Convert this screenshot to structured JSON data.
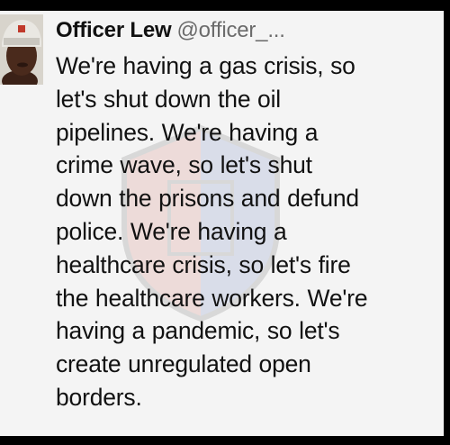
{
  "tweet": {
    "display_name": "Officer Lew",
    "handle": "@officer_...",
    "text_lines": [
      "We're having a gas crisis, so",
      "let's shut down the oil",
      "pipelines. We're having a",
      "crime wave, so let's shut",
      "down the prisons and defund",
      "police. We're having a",
      "healthcare crisis, so let's fire",
      "the healthcare workers. We're",
      "having a pandemic, so let's",
      "create unregulated open",
      "borders."
    ]
  },
  "avatar": {
    "icon": "profile-photo",
    "background_color": "#d8d4cc",
    "skin_color": "#4a2a1c",
    "cap_color": "#e9e7e2",
    "cap_accent_color": "#c0392b"
  },
  "watermark": {
    "icon": "police-badge-shield",
    "left_color": "#c0392b",
    "right_color": "#2c4aa8"
  },
  "colors": {
    "card_background": "#f4f4f4",
    "text": "#111111",
    "handle": "#6b6b6b"
  }
}
